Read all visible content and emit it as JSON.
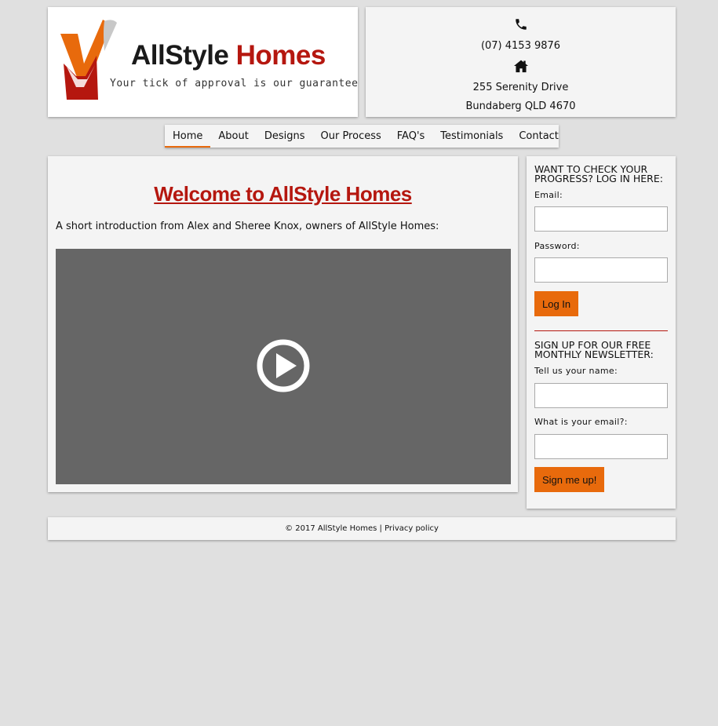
{
  "brand": {
    "name_part1": "AllStyle",
    "name_part2": "Homes",
    "tagline": "Your tick of approval is our guarantee",
    "accent_color": "#e86a0c",
    "brand_red": "#b5170f"
  },
  "contact": {
    "phone_icon": "phone-icon",
    "phone": "(07) 4153 9876",
    "home_icon": "home-icon",
    "address_line1": "255 Serenity Drive",
    "address_line2": "Bundaberg QLD 4670"
  },
  "nav": {
    "items": [
      {
        "label": "Home",
        "active": true
      },
      {
        "label": "About"
      },
      {
        "label": "Designs"
      },
      {
        "label": "Our Process"
      },
      {
        "label": "FAQ's"
      },
      {
        "label": "Testimonials"
      },
      {
        "label": "Contact"
      }
    ]
  },
  "main": {
    "title": "Welcome to AllStyle Homes",
    "intro": "A short introduction from Alex and Sheree Knox, owners of AllStyle Homes:",
    "video_icon": "play-icon"
  },
  "sidebar": {
    "login": {
      "heading": "WANT TO CHECK YOUR PROGRESS? LOG IN HERE:",
      "email_label": "Email:",
      "email_value": "",
      "password_label": "Password:",
      "password_value": "",
      "button": "Log In"
    },
    "newsletter": {
      "heading": "SIGN UP FOR OUR FREE MONTHLY NEWSLETTER:",
      "name_label": "Tell us your name:",
      "name_value": "",
      "email_label": "What is your email?:",
      "email_value": "",
      "button": "Sign me up!"
    }
  },
  "footer": {
    "copyright": "© 2017 AllStyle Homes |",
    "privacy": "Privacy policy"
  }
}
